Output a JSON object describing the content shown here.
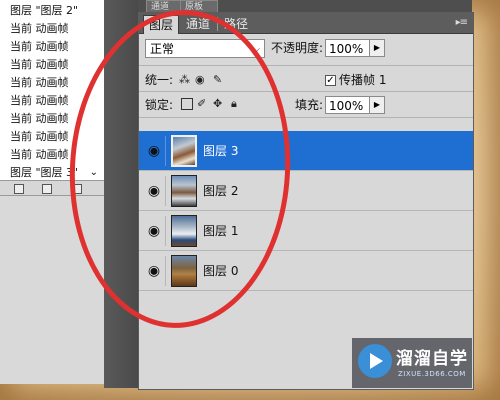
{
  "history": {
    "items": [
      {
        "label": "图层 \"图层 2\""
      },
      {
        "label": "当前 动画帧"
      },
      {
        "label": "当前 动画帧"
      },
      {
        "label": "当前 动画帧"
      },
      {
        "label": "当前 动画帧"
      },
      {
        "label": "当前 动画帧"
      },
      {
        "label": "当前 动画帧"
      },
      {
        "label": "当前 动画帧"
      },
      {
        "label": "当前 动画帧"
      },
      {
        "label": "图层 \"图层 3\""
      }
    ]
  },
  "top_tabs": [
    "通道",
    "原板"
  ],
  "panel": {
    "tabs": [
      {
        "label": "图层",
        "active": true
      },
      {
        "label": "通道",
        "active": false
      },
      {
        "label": "路径",
        "active": false
      }
    ],
    "menu_icon": "panel-menu-icon",
    "blend_mode": "正常",
    "opacity_label": "不透明度:",
    "opacity_value": "100%",
    "unify_label": "统一:",
    "propagate_label": "传播帧 1",
    "propagate_checked": true,
    "lock_label": "锁定:",
    "fill_label": "填充:",
    "fill_value": "100%"
  },
  "layers": [
    {
      "name": "图层 3",
      "selected": true
    },
    {
      "name": "图层 2",
      "selected": false
    },
    {
      "name": "图层 1",
      "selected": false
    },
    {
      "name": "图层 0",
      "selected": false
    }
  ],
  "colors": {
    "selection": "#1f6fd3",
    "annotation": "#e03131"
  },
  "watermark": {
    "title": "溜溜自学",
    "url": "ZIXUE.3D66.COM"
  }
}
